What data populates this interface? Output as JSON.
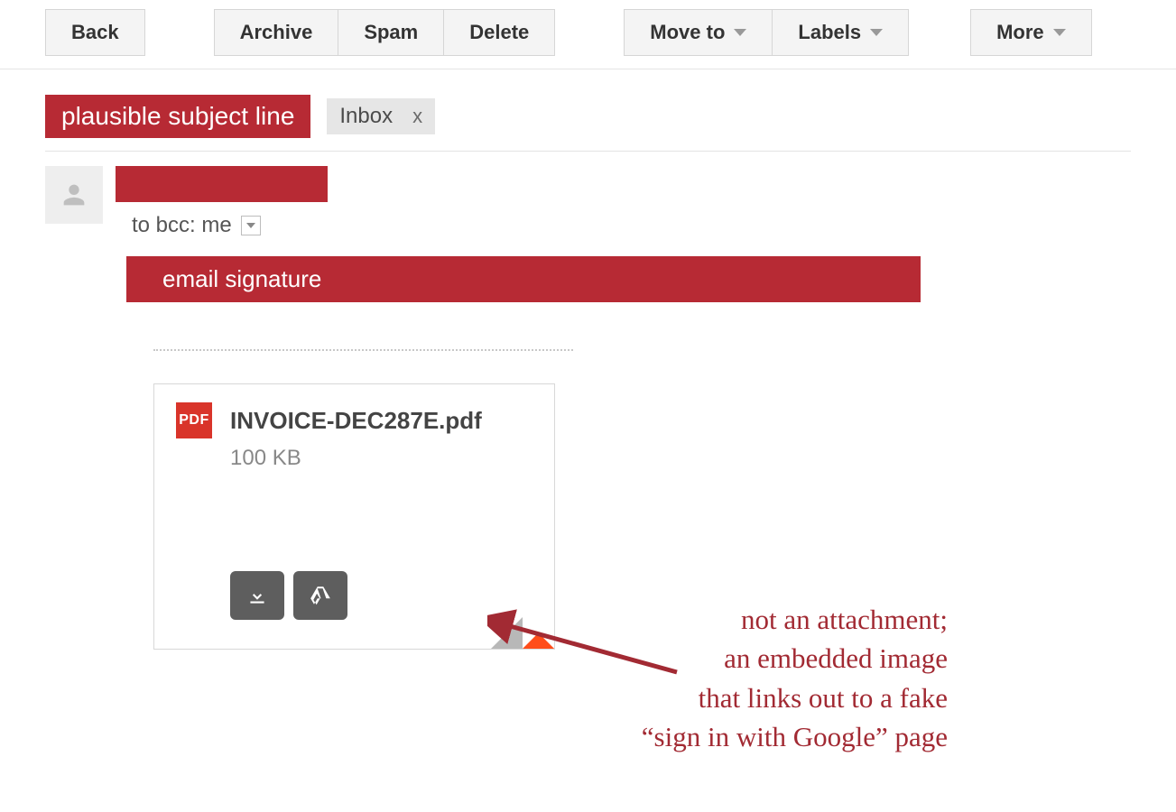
{
  "toolbar": {
    "back": "Back",
    "archive": "Archive",
    "spam": "Spam",
    "delete": "Delete",
    "move_to": "Move to",
    "labels": "Labels",
    "more": "More"
  },
  "subject": {
    "redacted_label": "plausible subject line",
    "inbox_chip": "Inbox",
    "chip_close": "x"
  },
  "sender": {
    "to_line": "to bcc: me"
  },
  "body": {
    "signature_label": "email signature"
  },
  "attachment": {
    "icon_text": "PDF",
    "filename": "INVOICE-DEC287E.pdf",
    "size": "100 KB"
  },
  "annotation": {
    "line1": "not an attachment;",
    "line2": "an embedded image",
    "line3": "that links out to a fake",
    "line4": "“sign in with Google” page"
  }
}
